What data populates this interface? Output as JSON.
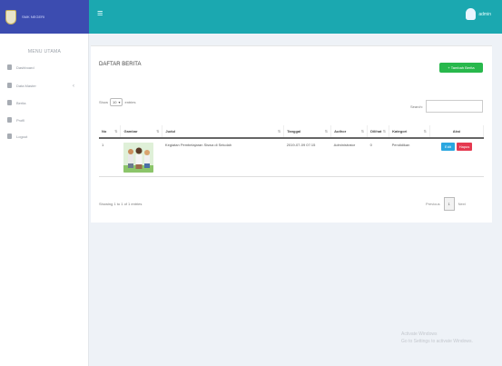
{
  "header": {
    "brand": "SMK NEGERI",
    "user": "admin"
  },
  "sidebar": {
    "heading": "MENU UTAMA",
    "items": [
      {
        "label": "Dashboard",
        "icon": "dashboard-icon"
      },
      {
        "label": "Data Master",
        "icon": "database-icon",
        "has_submenu": true
      },
      {
        "label": "Berita",
        "icon": "news-icon"
      },
      {
        "label": "Profil",
        "icon": "user-icon"
      },
      {
        "label": "Logout",
        "icon": "logout-icon"
      }
    ]
  },
  "content": {
    "title": "DAFTAR BERITA",
    "add_button": "+ Tambah Berita",
    "show_label": "Show",
    "entries_value": "10",
    "entries_label": "entries",
    "search_label": "Search:",
    "search_value": "",
    "columns": [
      "No",
      "Gambar",
      "Judul",
      "Tanggal",
      "Author",
      "Dilihat",
      "Kategori",
      "Aksi"
    ],
    "rows": [
      {
        "no": "1",
        "judul": "Kegiatan Pembelajaran Siswa di Sekolah",
        "tanggal": "2019-07-09 07:15",
        "author": "Administrator",
        "dilihat": "0",
        "kategori": "Pendidikan",
        "edit_label": "Edit",
        "delete_label": "Hapus"
      }
    ],
    "info": "Showing 1 to 1 of 1 entries",
    "previous_label": "Previous",
    "page": "1",
    "next_label": "Next"
  },
  "watermark": {
    "line1": "Activate Windows",
    "line2": "Go to Settings to activate Windows."
  },
  "colors": {
    "topbar": "#1ba8b0",
    "brand": "#3c4cb0",
    "add_button": "#28b84c",
    "edit_button": "#2ba7e0",
    "delete_button": "#e53950"
  }
}
